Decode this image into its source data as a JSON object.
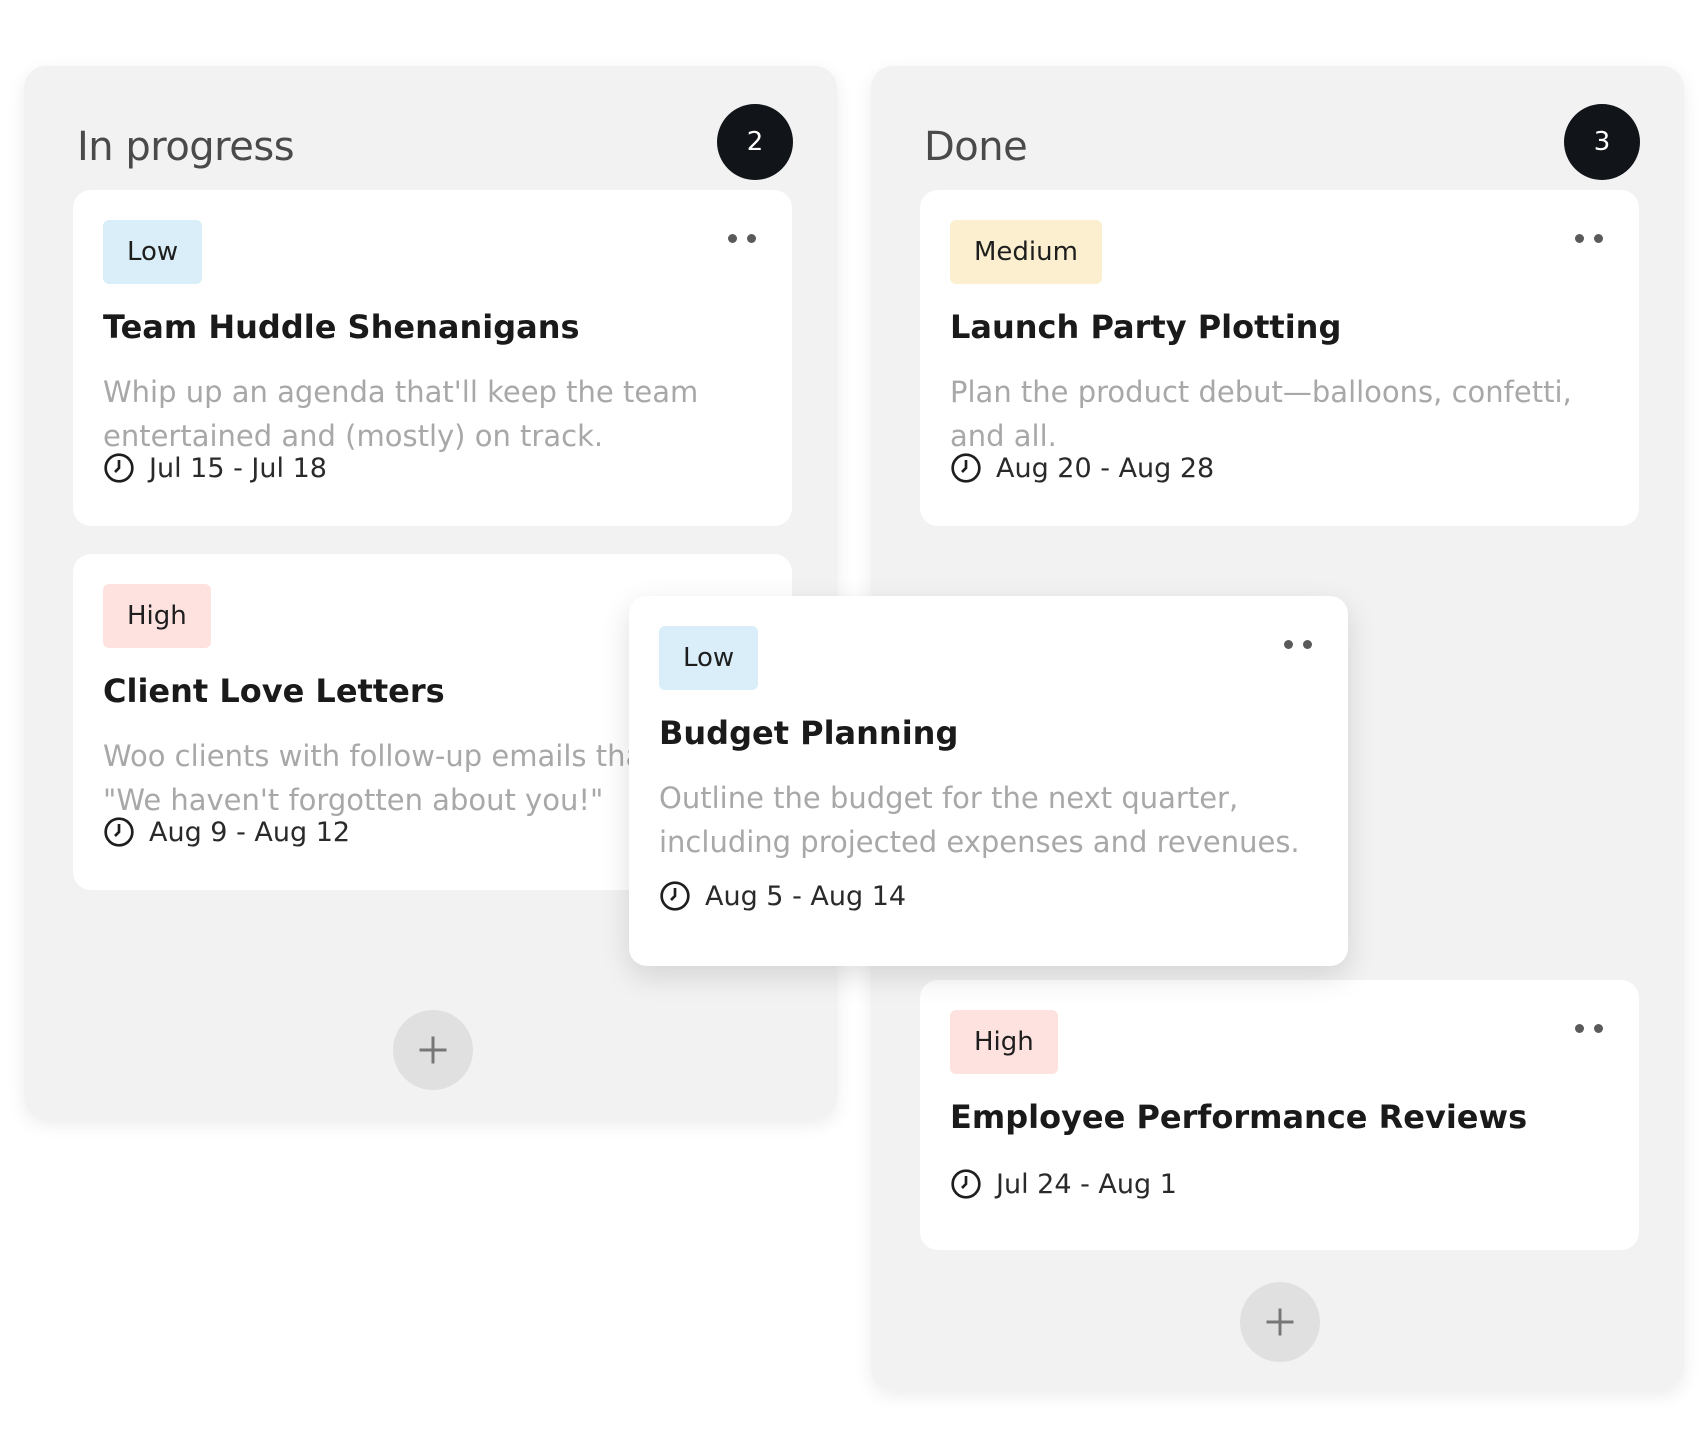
{
  "columns": [
    {
      "title": "In progress",
      "count": "2",
      "cards": [
        {
          "priority": "Low",
          "title": "Team Huddle Shenanigans",
          "description": "Whip up an agenda that'll keep the team entertained and (mostly) on track.",
          "date": "Jul 15 - Jul 18"
        },
        {
          "priority": "High",
          "title": "Client Love Letters",
          "description": "Woo clients with follow-up emails that say \"We haven't forgotten about you!\"",
          "date": "Aug 9 - Aug 12"
        }
      ]
    },
    {
      "title": "Done",
      "count": "3",
      "cards": [
        {
          "priority": "Medium",
          "title": "Launch Party Plotting",
          "description": "Plan the product debut—balloons, confetti, and all.",
          "date": "Aug 20 - Aug 28"
        },
        {
          "priority": "High",
          "title": "Employee Performance Reviews",
          "date": "Jul 24 - Aug 1"
        }
      ]
    }
  ],
  "dragging_card": {
    "priority": "Low",
    "title": "Budget Planning",
    "description": "Outline the budget for the next quarter, including projected expenses and revenues.",
    "date": "Aug 5 - Aug 14"
  },
  "icons": {
    "more": "more-horizontal-icon",
    "date": "clock-icon",
    "add": "plus-icon"
  },
  "colors": {
    "column_bg": "#f2f2f2",
    "badge_bg": "#111418",
    "tag_low": "#d9eef8",
    "tag_high": "#fde2e0",
    "tag_medium": "#fbefcf",
    "description_text": "#a8a8a8"
  }
}
